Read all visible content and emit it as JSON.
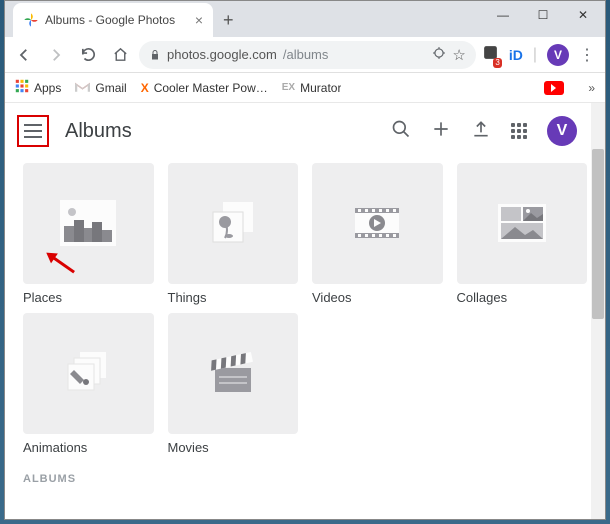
{
  "window": {
    "tab_title": "Albums - Google Photos",
    "minimize": "—",
    "maximize": "☐",
    "close": "✕"
  },
  "toolbar": {
    "url_host": "photos.google.com",
    "url_path": "/albums",
    "star": "☆",
    "avatar_letter": "V"
  },
  "bookmarks": {
    "apps": "Apps",
    "gmail": "Gmail",
    "b2": "Cooler Master Pow…",
    "b3": "Murator",
    "overflow": "»"
  },
  "header": {
    "title": "Albums",
    "avatar_letter": "V"
  },
  "albums": [
    {
      "label": "Places"
    },
    {
      "label": "Things"
    },
    {
      "label": "Videos"
    },
    {
      "label": "Collages"
    },
    {
      "label": "Animations"
    },
    {
      "label": "Movies"
    }
  ],
  "section": "ALBUMS"
}
